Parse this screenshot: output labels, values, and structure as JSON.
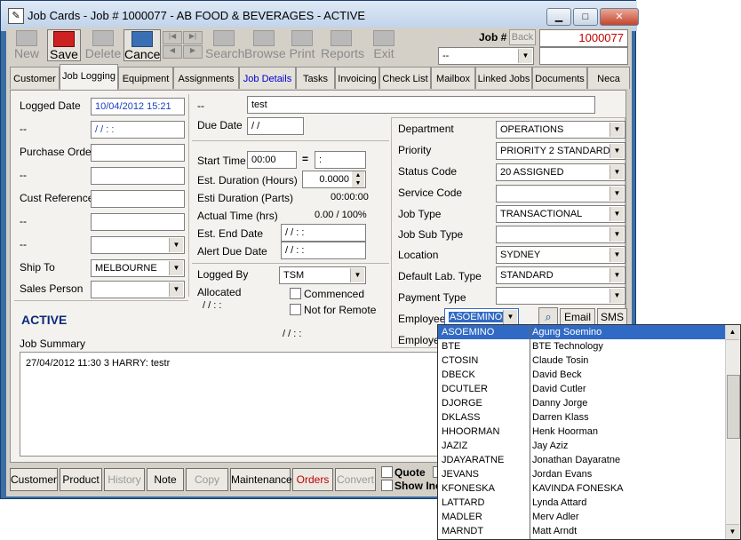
{
  "title": "Job Cards - Job # 1000077 - AB FOOD & BEVERAGES - ACTIVE",
  "toolbar": {
    "new": "New",
    "save": "Save",
    "delete": "Delete",
    "cancel": "Cance",
    "search": "Search",
    "browse": "Browse",
    "print": "Print",
    "reports": "Reports",
    "exit": "Exit"
  },
  "job": {
    "label": "Job #",
    "back": "Back",
    "number": "1000077",
    "filter": "--"
  },
  "tabs": {
    "customer": "Customer",
    "job_logging": "Job Logging",
    "equipment": "Equipment",
    "assignments": "Assignments",
    "job_details": "Job Details",
    "tasks": "Tasks",
    "invoicing": "Invoicing",
    "check_list": "Check List",
    "mailbox": "Mailbox",
    "linked_jobs": "Linked Jobs",
    "documents": "Documents",
    "neca": "Neca"
  },
  "left": {
    "logged_date_label": "Logged Date",
    "logged_date": "10/04/2012 15:21",
    "dash1_label": "--",
    "dash1_value": "/ /       : :",
    "po_label": "Purchase Order",
    "dash2_label": "--",
    "cust_ref_label": "Cust Reference",
    "dash3_label": "--",
    "dash4_label": "--",
    "ship_to_label": "Ship To",
    "ship_to": "MELBOURNE",
    "sales_person_label": "Sales Person",
    "status": "ACTIVE",
    "job_summary_label": "Job Summary",
    "summary_text": "27/04/2012 11:30 3 HARRY: testr"
  },
  "middle": {
    "dash_label": "--",
    "dash_value": "test",
    "due_date_label": "Due Date",
    "due_date": "/ /",
    "start_time_label": "Start Time",
    "start_time": "00:00",
    "equals": "=",
    "start_time_right": ":",
    "est_duration_label": "Est. Duration (Hours)",
    "est_duration": "0.0000",
    "esti_duration_parts_label": "Esti Duration (Parts)",
    "esti_duration_parts": "00:00:00",
    "actual_time_label": "Actual Time (hrs)",
    "actual_time": "0.00 / 100%",
    "est_end_date_label": "Est. End Date",
    "est_end_date": "/ /       : :",
    "alert_due_date_label": "Alert Due Date",
    "alert_due_date": "/ /       : :",
    "logged_by_label": "Logged By",
    "logged_by": "TSM",
    "allocated_label": "Allocated",
    "allocated": "/ /       : :",
    "commenced_label": "Commenced",
    "not_for_remote_label": "Not for Remote",
    "bottom_datetime": "/ /       : :"
  },
  "right": {
    "department_label": "Department",
    "department": "OPERATIONS",
    "priority_label": "Priority",
    "priority": "PRIORITY 2 STANDARD",
    "status_code_label": "Status Code",
    "status_code": "20 ASSIGNED",
    "service_code_label": "Service Code",
    "job_type_label": "Job Type",
    "job_type": "TRANSACTIONAL",
    "job_sub_type_label": "Job Sub Type",
    "location_label": "Location",
    "location": "SYDNEY",
    "default_lab_type_label": "Default Lab. Type",
    "default_lab_type": "STANDARD",
    "payment_type_label": "Payment Type",
    "employee_label": "Employee",
    "employee": "ASOEMINO",
    "email": "Email",
    "sms": "SMS",
    "employee2_label": "Employee"
  },
  "bottom": {
    "customer": "Customer",
    "product": "Product",
    "history": "History",
    "note": "Note",
    "copy": "Copy",
    "maintenance": "Maintenance",
    "orders": "Orders",
    "convert": "Convert",
    "quote": "Quote",
    "show_inc": "Show Inc"
  },
  "employees": [
    {
      "code": "ASOEMINO",
      "name": "Agung Soemino"
    },
    {
      "code": "BTE",
      "name": "BTE Technology"
    },
    {
      "code": "CTOSIN",
      "name": "Claude Tosin"
    },
    {
      "code": "DBECK",
      "name": "David Beck"
    },
    {
      "code": "DCUTLER",
      "name": "David Cutler"
    },
    {
      "code": "DJORGE",
      "name": "Danny Jorge"
    },
    {
      "code": "DKLASS",
      "name": "Darren Klass"
    },
    {
      "code": "HHOORMAN",
      "name": "Henk Hoorman"
    },
    {
      "code": "JAZIZ",
      "name": "Jay Aziz"
    },
    {
      "code": "JDAYARATNE",
      "name": "Jonathan Dayaratne"
    },
    {
      "code": "JEVANS",
      "name": "Jordan Evans"
    },
    {
      "code": "KFONESKA",
      "name": "KAVINDA FONESKA"
    },
    {
      "code": "LATTARD",
      "name": "Lynda Attard"
    },
    {
      "code": "MADLER",
      "name": "Merv Adler"
    },
    {
      "code": "MARNDT",
      "name": "Matt Arndt"
    }
  ]
}
